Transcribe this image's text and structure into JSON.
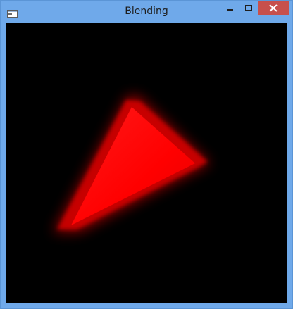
{
  "window": {
    "title": "Blending",
    "controls": {
      "minimize": "minimize",
      "maximize": "maximize",
      "close": "close"
    }
  },
  "scene": {
    "background_color": "#000000",
    "shape": "triangle",
    "fill_color": "#ff0000",
    "glow_color": "#b80000",
    "blending": "alpha"
  },
  "colors": {
    "frame": "#6fa9ea",
    "close_button": "#c7504c"
  }
}
